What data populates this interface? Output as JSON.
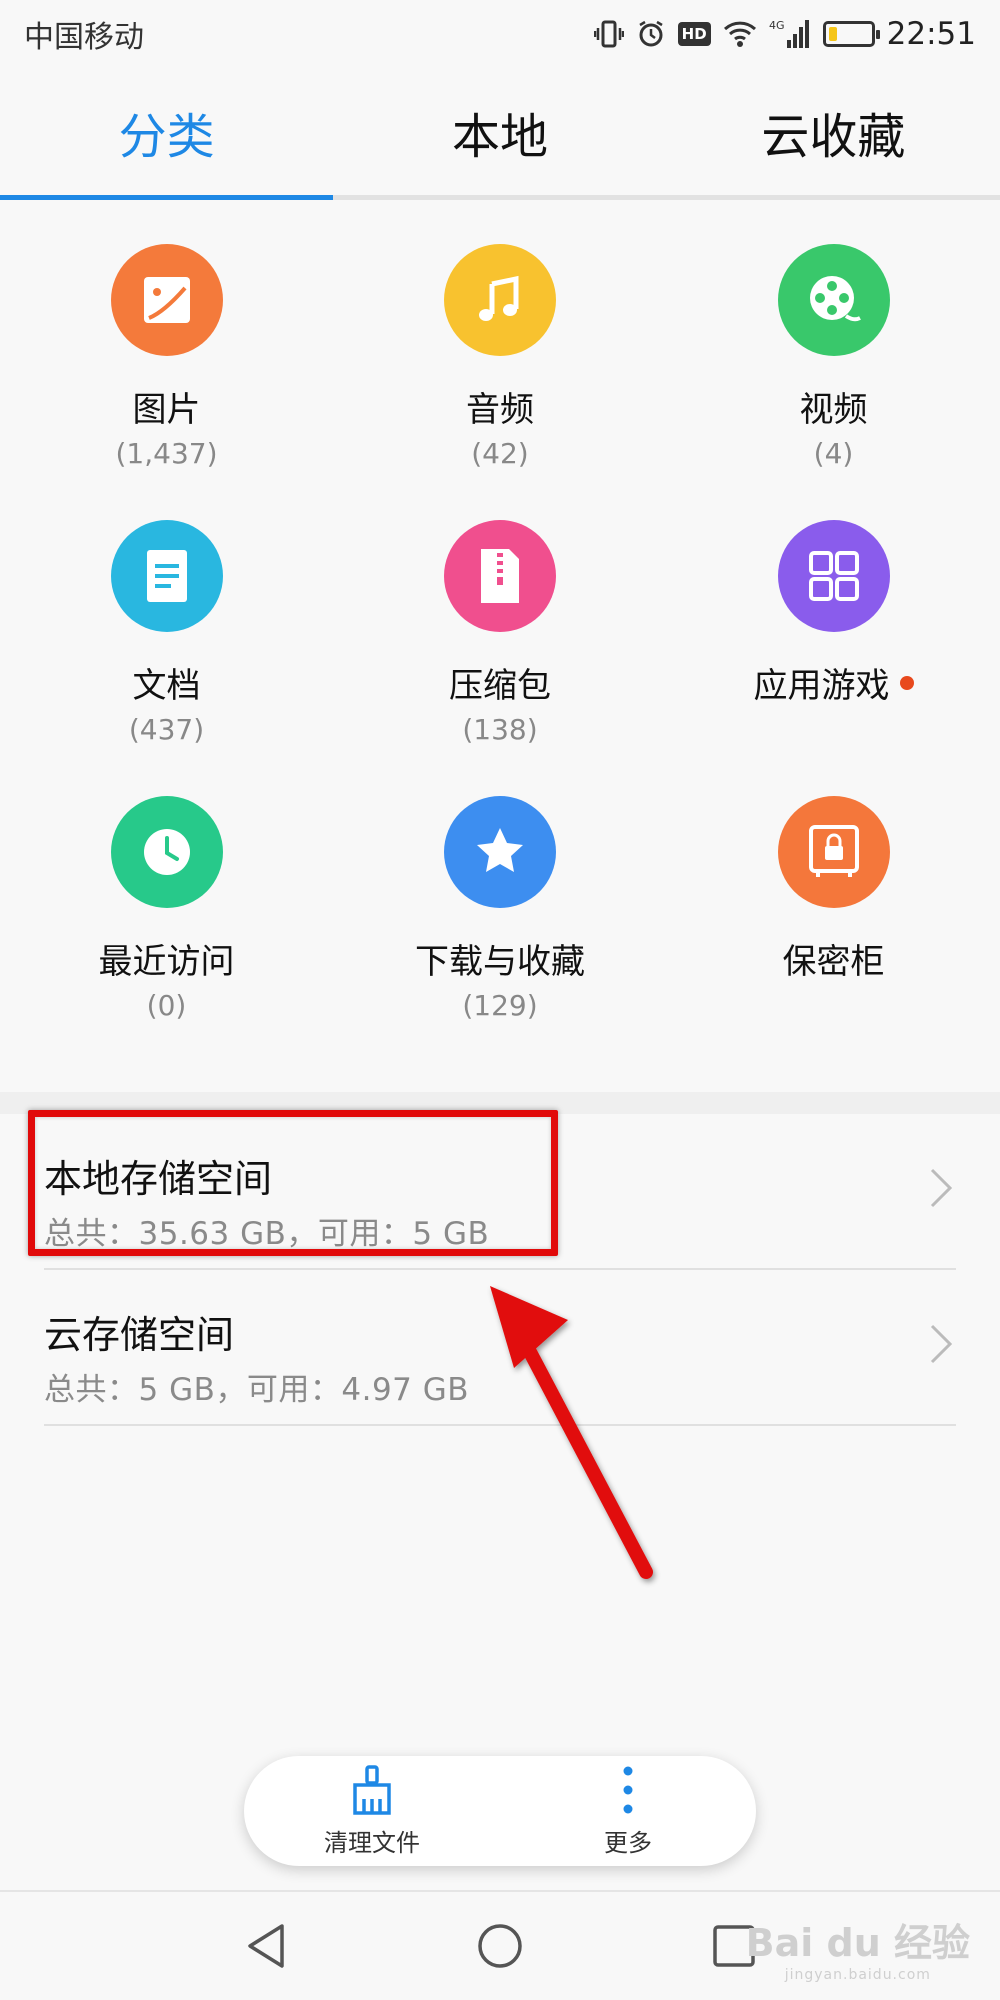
{
  "status_bar": {
    "carrier": "中国移动",
    "hd": "HD",
    "network": "4G",
    "time": "22:51",
    "battery_level": 0.2,
    "battery_color": "#f5c518"
  },
  "tabs": [
    {
      "label": "分类",
      "active": true
    },
    {
      "label": "本地",
      "active": false
    },
    {
      "label": "云收藏",
      "active": false
    }
  ],
  "accent_color": "#1e88e5",
  "categories": [
    {
      "label": "图片",
      "count": "(1,437)",
      "icon": "image-icon",
      "color": "#f47a3b"
    },
    {
      "label": "音频",
      "count": "(42)",
      "icon": "music-note-icon",
      "color": "#f8c22f"
    },
    {
      "label": "视频",
      "count": "(4)",
      "icon": "film-reel-icon",
      "color": "#39c86b"
    },
    {
      "label": "文档",
      "count": "(437)",
      "icon": "document-icon",
      "color": "#29b7e0"
    },
    {
      "label": "压缩包",
      "count": "(138)",
      "icon": "archive-zip-icon",
      "color": "#f04f8e"
    },
    {
      "label": "应用游戏",
      "count": "",
      "icon": "apps-grid-icon",
      "color": "#8a5cec",
      "badge_color": "#e8491d"
    },
    {
      "label": "最近访问",
      "count": "(0)",
      "icon": "clock-icon",
      "color": "#27c98a"
    },
    {
      "label": "下载与收藏",
      "count": "(129)",
      "icon": "star-icon",
      "color": "#3d8ef0"
    },
    {
      "label": "保密柜",
      "count": "",
      "icon": "safe-lock-icon",
      "color": "#f4773b"
    }
  ],
  "storage": [
    {
      "title": "本地存储空间",
      "detail": "总共：35.63 GB，可用：5 GB"
    },
    {
      "title": "云存储空间",
      "detail": "总共：5 GB，可用：4.97 GB"
    }
  ],
  "bottom_bar": {
    "clean_label": "清理文件",
    "more_label": "更多"
  },
  "annotation_color": "#e10a0a",
  "watermark": {
    "text": "Bai du 经验",
    "url_text": "jingyan.baidu.com"
  }
}
